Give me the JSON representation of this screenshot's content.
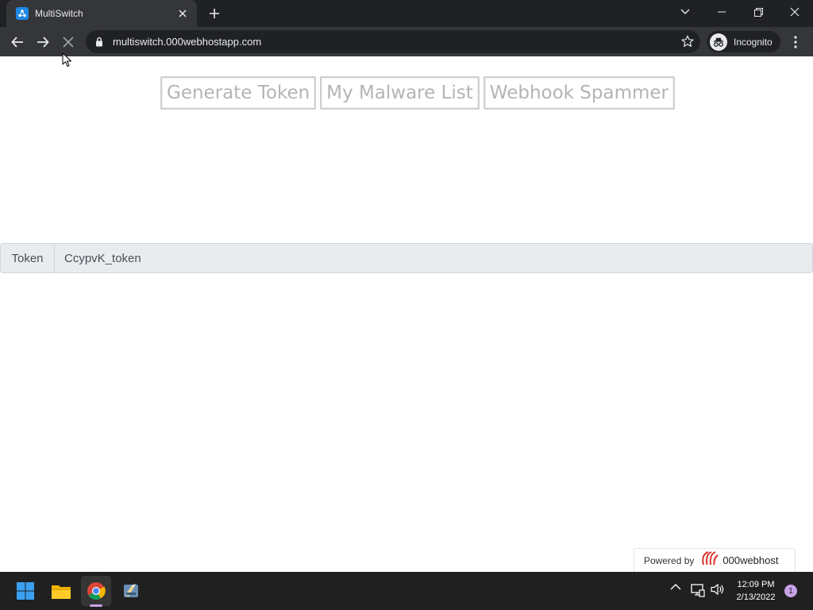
{
  "browser": {
    "tab": {
      "title": "MultiSwitch"
    },
    "url": "multiswitch.000webhostapp.com",
    "incognito_label": "Incognito"
  },
  "page": {
    "buttons": [
      {
        "label": "Generate Token"
      },
      {
        "label": "My Malware List"
      },
      {
        "label": "Webhook Spammer"
      }
    ],
    "token": {
      "label": "Token",
      "value": "CcypvK_token"
    },
    "powered_by": {
      "text": "Powered by",
      "brand": "000webhost"
    }
  },
  "taskbar": {
    "time": "12:09 PM",
    "date": "2/13/2022",
    "notification_count": "1"
  },
  "colors": {
    "tabstrip": "#202124",
    "toolbar": "#35363a",
    "taskbar": "#202020",
    "brand_red": "#d8322a",
    "input_group_bg": "#e9ecef"
  }
}
